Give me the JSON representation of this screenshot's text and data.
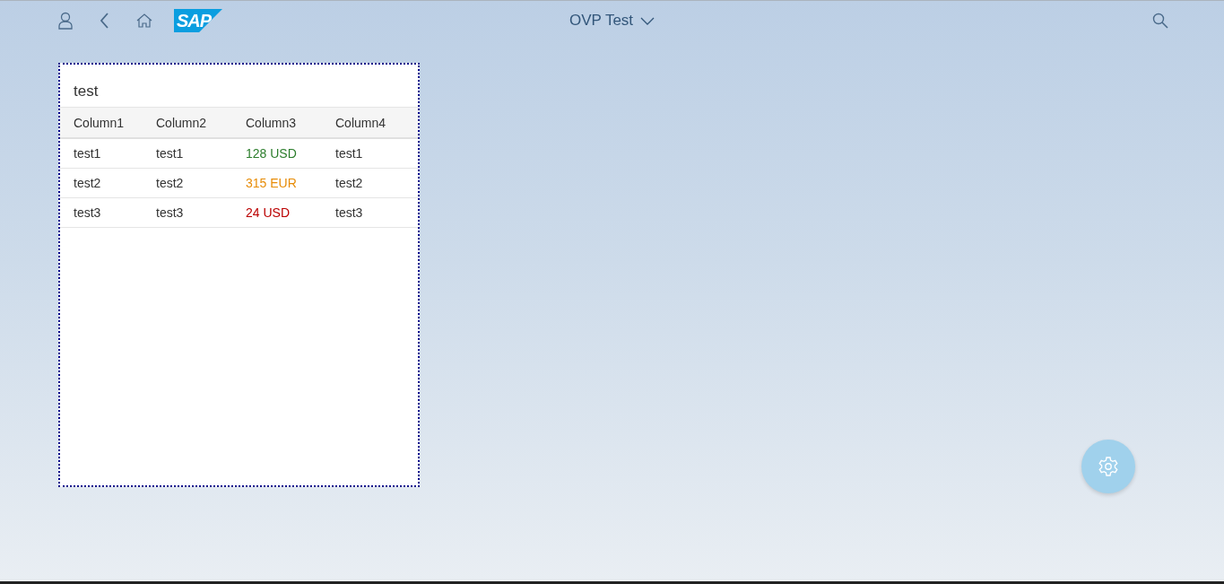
{
  "shell": {
    "logo": "SAP",
    "title": "OVP Test"
  },
  "card": {
    "title": "test",
    "columns": [
      "Column1",
      "Column2",
      "Column3",
      "Column4"
    ],
    "rows": [
      {
        "cells": [
          "test1",
          "test1",
          "128 USD",
          "test1"
        ],
        "color": "#2b7d2b"
      },
      {
        "cells": [
          "test2",
          "test2",
          "315 EUR",
          "test2"
        ],
        "color": "#e78c07"
      },
      {
        "cells": [
          "test3",
          "test3",
          "24 USD",
          "test3"
        ],
        "color": "#bb0000"
      }
    ]
  }
}
